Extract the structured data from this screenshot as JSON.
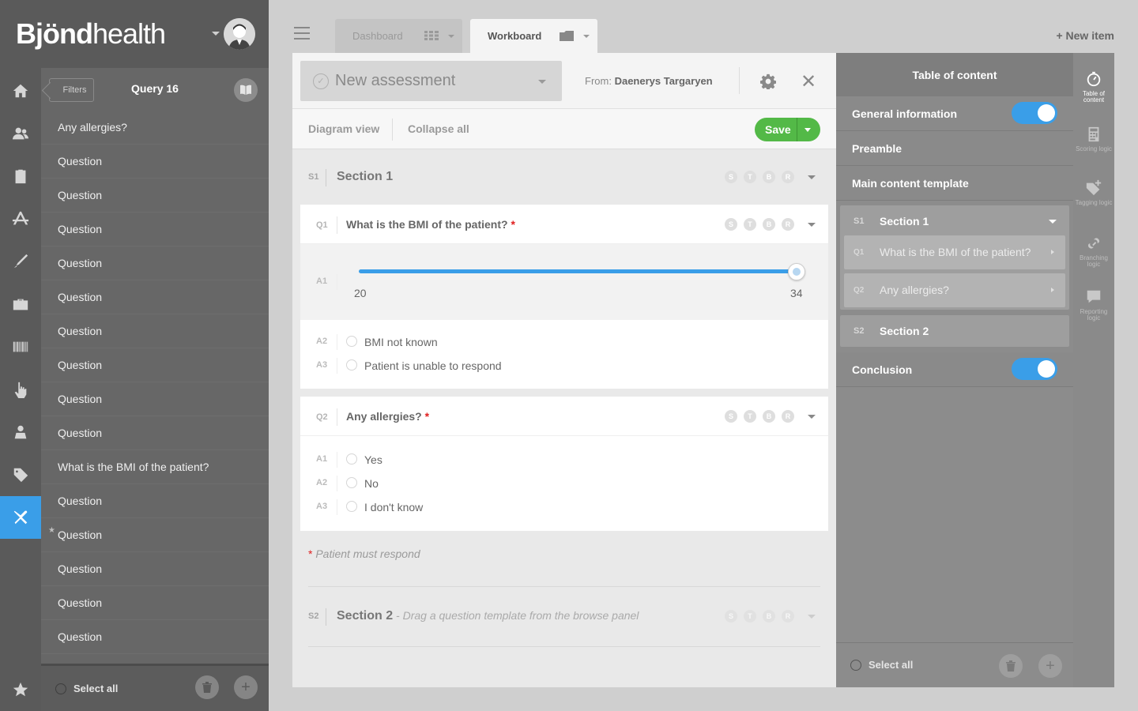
{
  "app": {
    "logo_bold": "Bjönd",
    "logo_thin": "health"
  },
  "rail": {
    "items": [
      "home-icon",
      "users-icon",
      "clipboard-icon",
      "app-store-icon",
      "pen-icon",
      "briefcase-icon",
      "barcode-icon",
      "hand-pointer-icon",
      "person-icon",
      "tag-icon",
      "tools-icon"
    ],
    "active": "tools-icon",
    "bottom": "star-icon"
  },
  "query_panel": {
    "filters_label": "Filters",
    "title": "Query 16",
    "items": [
      {
        "label": "Any allergies?",
        "starred": false
      },
      {
        "label": "Question",
        "starred": false
      },
      {
        "label": "Question",
        "starred": false
      },
      {
        "label": "Question",
        "starred": false
      },
      {
        "label": "Question",
        "starred": false
      },
      {
        "label": "Question",
        "starred": false
      },
      {
        "label": "Question",
        "starred": false
      },
      {
        "label": "Question",
        "starred": false
      },
      {
        "label": "Question",
        "starred": false
      },
      {
        "label": "Question",
        "starred": false
      },
      {
        "label": "What is the BMI of the patient?",
        "starred": false
      },
      {
        "label": "Question",
        "starred": false
      },
      {
        "label": "Question",
        "starred": true
      },
      {
        "label": "Question",
        "starred": false
      },
      {
        "label": "Question",
        "starred": false
      },
      {
        "label": "Question",
        "starred": false
      }
    ],
    "select_all": "Select all"
  },
  "tabs": [
    {
      "label": "Dashboard",
      "active": false
    },
    {
      "label": "Workboard",
      "active": true
    }
  ],
  "new_item": "+ New item",
  "assessment": {
    "title": "New assessment",
    "from_label": "From:",
    "from_name": "Daenerys Targaryen",
    "diagram_view": "Diagram view",
    "collapse_all": "Collapse all",
    "save": "Save",
    "badges": [
      "S",
      "T",
      "B",
      "R"
    ],
    "sections": [
      {
        "num": "S1",
        "title": "Section 1"
      },
      {
        "num": "S2",
        "title": "Section 2",
        "hint": " - Drag a question template from the browse panel"
      }
    ],
    "q1": {
      "num": "Q1",
      "text": "What is the BMI of the patient?",
      "required": "*",
      "slider": {
        "num": "A1",
        "min_label": "20",
        "max_label": "34",
        "value_fraction": 1.0
      },
      "answers": [
        {
          "num": "A2",
          "text": "BMI not known"
        },
        {
          "num": "A3",
          "text": "Patient is unable to respond"
        }
      ]
    },
    "q2": {
      "num": "Q2",
      "text": "Any allergies?",
      "required": "*",
      "answers": [
        {
          "num": "A1",
          "text": "Yes"
        },
        {
          "num": "A2",
          "text": "No"
        },
        {
          "num": "A3",
          "text": "I don't know"
        }
      ]
    },
    "note_star": "*",
    "note": "Patient must respond"
  },
  "toc": {
    "title": "Table of content",
    "general_information": "General information",
    "preamble": "Preamble",
    "main_content": "Main content template",
    "section1": {
      "num": "S1",
      "title": "Section 1"
    },
    "questions": [
      {
        "num": "Q1",
        "text": "What is the BMI of the patient?"
      },
      {
        "num": "Q2",
        "text": "Any allergies?"
      }
    ],
    "section2": {
      "num": "S2",
      "title": "Section 2"
    },
    "conclusion": "Conclusion",
    "select_all": "Select all"
  },
  "right_rail": [
    {
      "label": "Table of content",
      "icon": "stopwatch-icon",
      "active": true
    },
    {
      "label": "Scoring logic",
      "icon": "calculator-icon",
      "active": false
    },
    {
      "label": "Tagging logic",
      "icon": "tag-plus-icon",
      "active": false
    },
    {
      "label": "Branching logic",
      "icon": "link-icon",
      "active": false
    },
    {
      "label": "Reporting logic",
      "icon": "speech-bubble-icon",
      "active": false
    }
  ],
  "colors": {
    "accent_blue": "#3a9ee8",
    "save_green": "#53b947",
    "required_red": "#e02020"
  }
}
